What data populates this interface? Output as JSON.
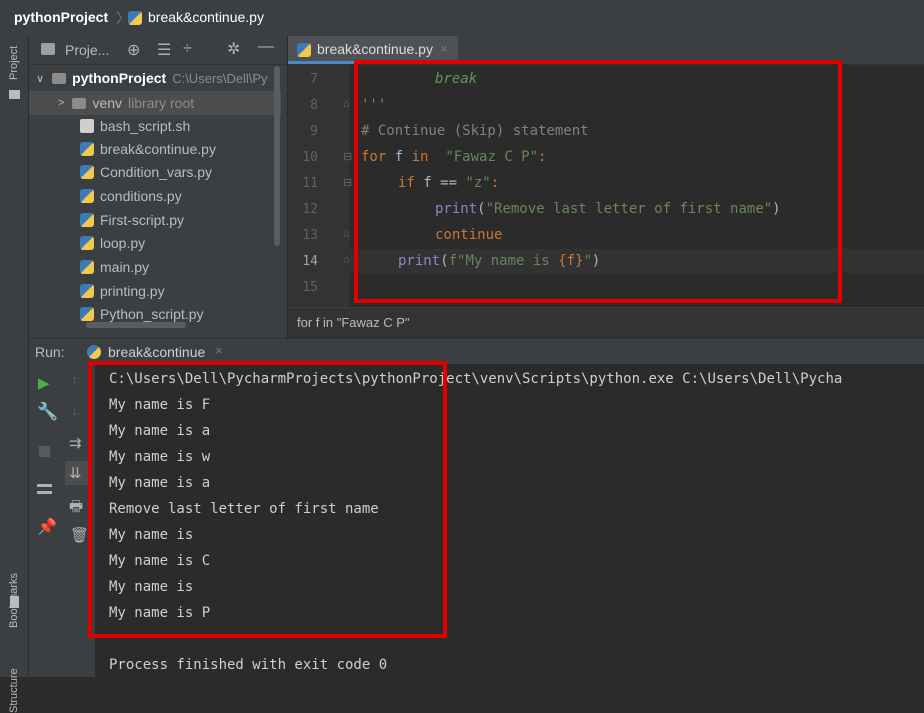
{
  "breadcrumb": {
    "project": "pythonProject",
    "file": "break&continue.py"
  },
  "sidebar": {
    "project_label": "Project",
    "bookmarks_label": "Bookmarks",
    "structure_label": "Structure"
  },
  "project_panel": {
    "title": "Proje...",
    "root": {
      "name": "pythonProject",
      "path": "C:\\Users\\Dell\\Py"
    },
    "venv": {
      "name": "venv",
      "note": "library root"
    },
    "files": [
      "bash_script.sh",
      "break&continue.py",
      "Condition_vars.py",
      "conditions.py",
      "First-script.py",
      "loop.py",
      "main.py",
      "printing.py",
      "Python_script.py"
    ]
  },
  "editor": {
    "tab": "break&continue.py",
    "line_numbers": [
      "7",
      "8",
      "9",
      "10",
      "11",
      "12",
      "13",
      "14",
      "15"
    ],
    "breadcrumb": "for f in \"Fawaz C P\""
  },
  "code": {
    "l7": "break",
    "l8": "'''",
    "l9": "# Continue (Skip) statement",
    "l10_for": "for",
    "l10_f": " f ",
    "l10_in": "in",
    "l10_str": "\"Fawaz C P\"",
    "l10_colon": ":",
    "l11_if": "if",
    "l11_rest": " f == ",
    "l11_str": "\"z\"",
    "l11_colon": ":",
    "l12_print": "print",
    "l12_open": "(",
    "l12_str": "\"Remove last letter of first name\"",
    "l12_close": ")",
    "l13": "continue",
    "l14_print": "print",
    "l14_open": "(",
    "l14_str1": "f\"My name is ",
    "l14_brace": "{f}",
    "l14_str2": "\"",
    "l14_close": ")"
  },
  "run": {
    "label": "Run:",
    "tab": "break&continue",
    "command": "C:\\Users\\Dell\\PycharmProjects\\pythonProject\\venv\\Scripts\\python.exe C:\\Users\\Dell\\Pycha",
    "output": [
      "My name is F",
      "My name is a",
      "My name is w",
      "My name is a",
      "Remove last letter of first name",
      "My name is",
      "My name is C",
      "My name is",
      "My name is P"
    ],
    "exit": "Process finished with exit code 0"
  },
  "colors": {
    "keyword": "#cc7832",
    "string": "#6a8759",
    "comment": "#808080",
    "builtin": "#a9b7c6",
    "highlight": "#e00000",
    "run_green": "#4caf50"
  }
}
